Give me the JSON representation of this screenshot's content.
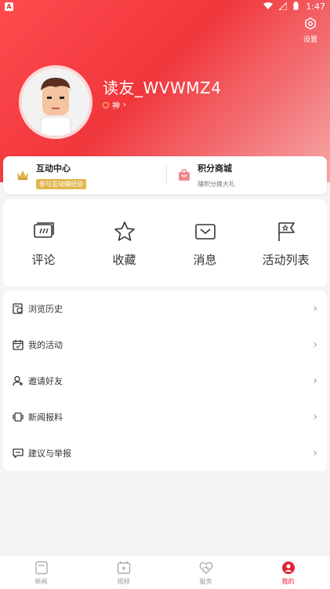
{
  "status_bar": {
    "time": "1:47"
  },
  "header": {
    "settings_label": "设置",
    "username": "读友_WVWMZ4",
    "level_label": "神"
  },
  "top_cards": [
    {
      "title": "互动中心",
      "subtitle": "参与互动赚经验"
    },
    {
      "title": "积分商城",
      "subtitle": "赚积分换大礼"
    }
  ],
  "grid": [
    {
      "label": "评论",
      "icon": "comment-icon"
    },
    {
      "label": "收藏",
      "icon": "star-icon"
    },
    {
      "label": "消息",
      "icon": "message-icon"
    },
    {
      "label": "活动列表",
      "icon": "activity-flag-icon"
    }
  ],
  "menu": [
    {
      "label": "浏览历史",
      "icon": "history-icon"
    },
    {
      "label": "我的活动",
      "icon": "calendar-icon"
    },
    {
      "label": "邀请好友",
      "icon": "invite-icon"
    },
    {
      "label": "新闻报料",
      "icon": "broadcast-icon"
    },
    {
      "label": "建议与举报",
      "icon": "feedback-icon"
    }
  ],
  "tabbar": [
    {
      "label": "新闻"
    },
    {
      "label": "视频"
    },
    {
      "label": "服务"
    },
    {
      "label": "我的"
    }
  ],
  "colors": {
    "brand_red": "#f0373c",
    "gold": "#e0b64c",
    "active_tab": "#e22233"
  }
}
